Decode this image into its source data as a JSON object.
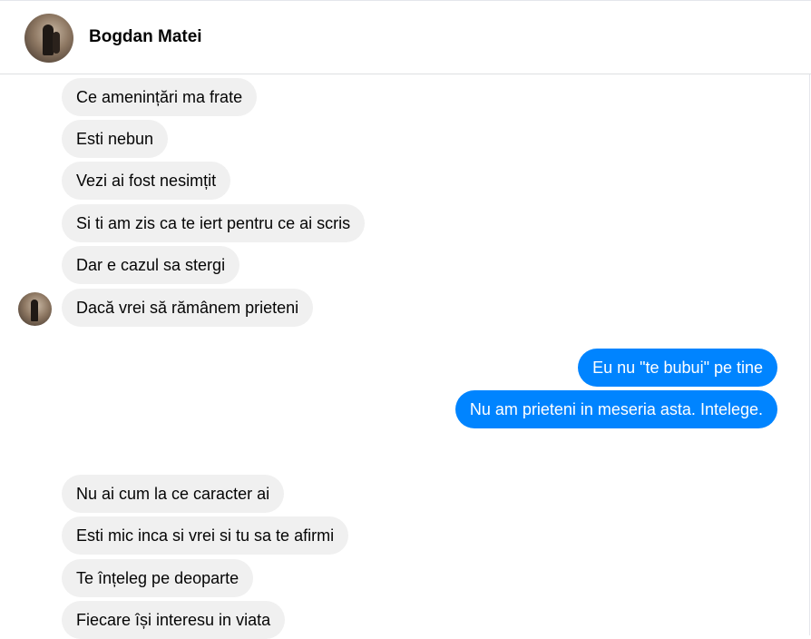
{
  "conversation": {
    "contact_name": "Bogdan Matei"
  },
  "messages": [
    {
      "from": "them",
      "text": "Ce amenințări ma frate"
    },
    {
      "from": "them",
      "text": "Esti nebun"
    },
    {
      "from": "them",
      "text": "Vezi ai fost nesimțit"
    },
    {
      "from": "them",
      "text": "Si ti am zis ca te iert pentru ce ai scris"
    },
    {
      "from": "them",
      "text": "Dar e cazul sa stergi"
    },
    {
      "from": "them",
      "text": "Dacă vrei să rămânem prieteni"
    },
    {
      "from": "me",
      "text": "Eu nu \"te bubui\" pe tine"
    },
    {
      "from": "me",
      "text": "Nu am prieteni in meseria asta. Intelege."
    },
    {
      "from": "them",
      "text": "Nu ai cum la ce caracter ai"
    },
    {
      "from": "them",
      "text": "Esti mic inca si vrei si tu sa te afirmi"
    },
    {
      "from": "them",
      "text": "Te înțeleg pe deoparte"
    },
    {
      "from": "them",
      "text": "Fiecare își interesu in viata"
    }
  ],
  "colors": {
    "outgoing_bubble": "#0084ff",
    "incoming_bubble": "#f0f0f0"
  }
}
